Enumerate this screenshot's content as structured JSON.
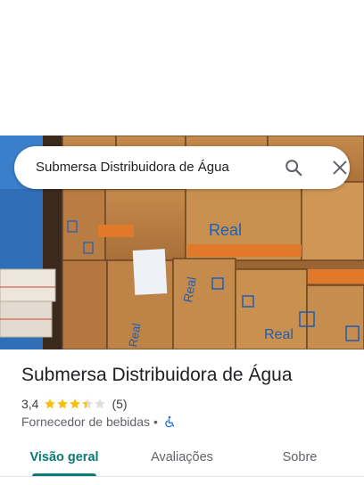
{
  "search": {
    "query": "Submersa Distribuidora de Água"
  },
  "icons": {
    "search": "search-icon",
    "close": "close-icon",
    "wheelchair": "wheelchair-accessible-icon"
  },
  "place": {
    "title": "Submersa Distribuidora de Água",
    "rating_text": "3,4",
    "rating": 3.4,
    "rating_max": 5,
    "review_count_text": "(5)",
    "category": "Fornecedor de bebidas",
    "separator": "•",
    "photo_box_brand": "Real"
  },
  "tabs": [
    {
      "label": "Visão geral",
      "active": true
    },
    {
      "label": "Avaliações",
      "active": false
    },
    {
      "label": "Sobre",
      "active": false
    }
  ],
  "colors": {
    "accent": "#0b7a75",
    "star": "#fbbc04",
    "star_empty": "#dadce0",
    "wheelchair": "#1a73e8",
    "box_brand": "#1d5fb5"
  }
}
